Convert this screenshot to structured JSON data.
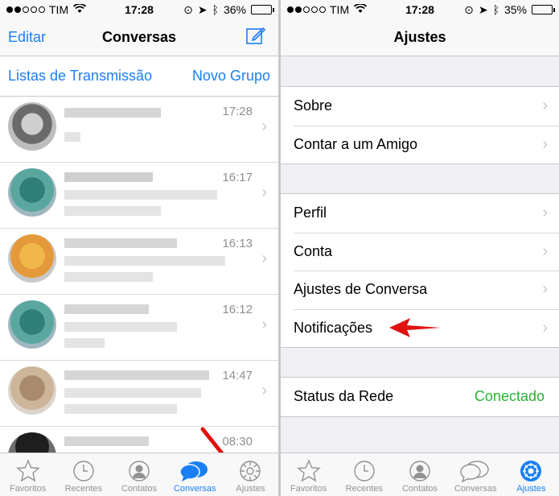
{
  "left": {
    "status": {
      "carrier": "TIM",
      "time": "17:28",
      "battery": "36%",
      "battery_level": 0.36
    },
    "nav": {
      "edit": "Editar",
      "title": "Conversas"
    },
    "subbar": {
      "broadcast": "Listas de Transmissão",
      "new_group": "Novo Grupo"
    },
    "chats": [
      {
        "time": "17:28"
      },
      {
        "time": "16:17"
      },
      {
        "time": "16:13"
      },
      {
        "time": "16:12"
      },
      {
        "time": "14:47"
      },
      {
        "time": "08:30"
      }
    ],
    "tabs": [
      "Favoritos",
      "Recentes",
      "Contatos",
      "Conversas",
      "Ajustes"
    ]
  },
  "right": {
    "status": {
      "carrier": "TIM",
      "time": "17:28",
      "battery": "35%",
      "battery_level": 0.35
    },
    "nav": {
      "title": "Ajustes"
    },
    "group1": [
      "Sobre",
      "Contar a um Amigo"
    ],
    "group2": [
      "Perfil",
      "Conta",
      "Ajustes de Conversa",
      "Notificações"
    ],
    "network": {
      "label": "Status da Rede",
      "value": "Conectado"
    },
    "tabs": [
      "Favoritos",
      "Recentes",
      "Contatos",
      "Conversas",
      "Ajustes"
    ]
  },
  "colors": {
    "accent": "#1a7ff5",
    "connected": "#2cb035",
    "annotation_arrow": "#e11111"
  }
}
